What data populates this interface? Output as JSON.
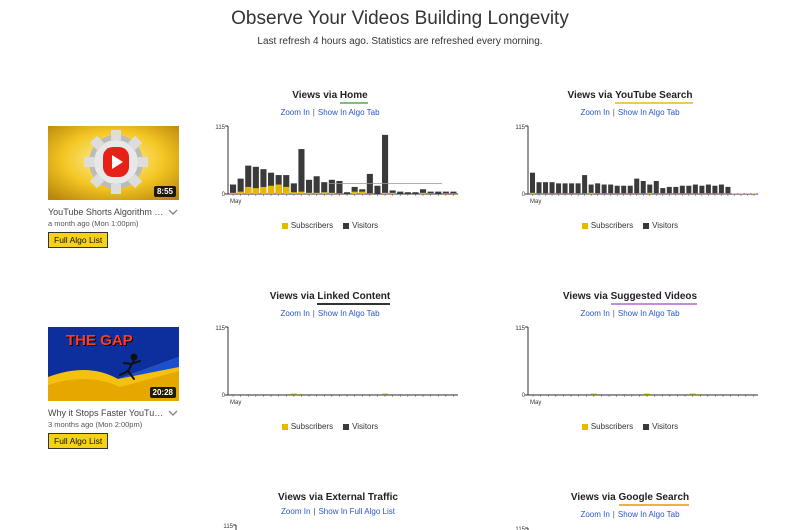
{
  "header": {
    "title": "Observe Your Videos Building Longevity",
    "subtitle": "Last refresh 4 hours ago. Statistics are refreshed every morning."
  },
  "colors": {
    "subscribers": "#e6b800",
    "visitors": "#3a3a3a",
    "home_underline": "#7cc27c",
    "search_underline": "#f2c94c",
    "linked_underline": "#333333",
    "suggested_underline": "#c98bd9",
    "external_underline": "#999999",
    "google_underline": "#f0b040",
    "button_bg": "#f7d117",
    "link": "#2a56c6"
  },
  "videos": [
    {
      "title": "YouTube Shorts Algorithm Explained",
      "date": "a month ago (Mon 1:00pm)",
      "duration": "8:55",
      "button": "Full Algo List",
      "thumb_icon": "shorts-gear-icon"
    },
    {
      "title": "Why it Stops Faster YouTube Growth",
      "date": "3 months ago (Mon 2:00pm)",
      "duration": "20:28",
      "button": "Full Algo List",
      "thumb_text": "THE GAP"
    }
  ],
  "common": {
    "views_via": "Views via",
    "zoom_in": "Zoom In",
    "show_in_algo_tab": "Show In Algo Tab",
    "show_in_full_algo_list": "Show In Full Algo List",
    "legend_subscribers": "Subscribers",
    "legend_visitors": "Visitors"
  },
  "chart_data": [
    {
      "type": "bar",
      "title": "Views via Home",
      "source": "Home",
      "ymax_label": "115",
      "ylim": [
        0,
        115
      ],
      "xlabel_first": "May",
      "reference_line": 18,
      "series": [
        {
          "name": "Subscribers",
          "values": [
            2,
            4,
            12,
            10,
            12,
            14,
            16,
            12,
            3,
            4,
            2,
            2,
            3,
            2,
            1,
            0,
            4,
            4,
            1,
            0,
            2,
            2,
            0,
            0,
            0,
            2,
            1,
            0,
            1,
            1
          ]
        },
        {
          "name": "Visitors",
          "values": [
            16,
            26,
            48,
            46,
            42,
            36,
            32,
            32,
            18,
            76,
            24,
            30,
            20,
            24,
            22,
            3,
            12,
            8,
            34,
            14,
            100,
            6,
            4,
            3,
            3,
            8,
            4,
            4,
            4,
            4
          ]
        }
      ]
    },
    {
      "type": "bar",
      "title": "Views via YouTube Search",
      "source": "YouTube Search",
      "ymax_label": "115",
      "ylim": [
        0,
        115
      ],
      "xlabel_first": "May",
      "series": [
        {
          "name": "Subscribers",
          "values": [
            2,
            1,
            1,
            1,
            1,
            1,
            1,
            1,
            1,
            2,
            1,
            1,
            1,
            1,
            1,
            1,
            1,
            1,
            2,
            1,
            1,
            1,
            1,
            1,
            1,
            1,
            1,
            1,
            1,
            1,
            1,
            1,
            1,
            1,
            1
          ]
        },
        {
          "name": "Visitors",
          "values": [
            36,
            20,
            20,
            20,
            18,
            18,
            18,
            18,
            32,
            16,
            18,
            16,
            16,
            14,
            14,
            14,
            26,
            22,
            16,
            22,
            10,
            12,
            12,
            14,
            14,
            16,
            14,
            16,
            14,
            16,
            12
          ]
        }
      ]
    },
    {
      "type": "bar",
      "title": "Views via Linked Content",
      "source": "Linked Content",
      "ymax_label": "115",
      "ylim": [
        0,
        115
      ],
      "xlabel_first": "May",
      "series": [
        {
          "name": "Subscribers",
          "values": [
            0,
            0,
            0,
            0,
            0,
            0,
            0,
            0,
            1,
            0,
            0,
            0,
            0,
            0,
            0,
            0,
            0,
            0,
            0,
            0,
            1,
            0,
            0,
            0,
            0,
            0,
            0,
            0,
            0,
            0
          ]
        },
        {
          "name": "Visitors",
          "values": [
            1,
            1,
            1,
            1,
            1,
            1,
            1,
            1,
            2,
            1,
            1,
            1,
            1,
            1,
            1,
            1,
            1,
            1,
            1,
            1,
            2,
            1,
            1,
            1,
            1,
            1,
            1,
            1,
            1,
            1
          ]
        }
      ]
    },
    {
      "type": "bar",
      "title": "Views via Suggested Videos",
      "source": "Suggested Videos",
      "ymax_label": "115",
      "ylim": [
        0,
        115
      ],
      "xlabel_first": "May",
      "series": [
        {
          "name": "Subscribers",
          "values": [
            0,
            0,
            0,
            0,
            0,
            0,
            0,
            0,
            1,
            0,
            0,
            0,
            0,
            0,
            0,
            1,
            0,
            0,
            0,
            0,
            0,
            1,
            0,
            0,
            0,
            0,
            0,
            0,
            0,
            0
          ]
        },
        {
          "name": "Visitors",
          "values": [
            1,
            1,
            1,
            1,
            1,
            1,
            1,
            1,
            2,
            1,
            1,
            1,
            1,
            1,
            1,
            2,
            1,
            1,
            1,
            1,
            1,
            2,
            1,
            1,
            1,
            1,
            1,
            1,
            1,
            1
          ]
        }
      ]
    },
    {
      "type": "bar",
      "title": "Views via External Traffic",
      "source": "External Traffic",
      "ymax_label": "115",
      "ylim": [
        0,
        115
      ],
      "series": []
    },
    {
      "type": "bar",
      "title": "Views via Google Search",
      "source": "Google Search",
      "ymax_label": "115",
      "ylim": [
        0,
        115
      ],
      "series": []
    }
  ]
}
